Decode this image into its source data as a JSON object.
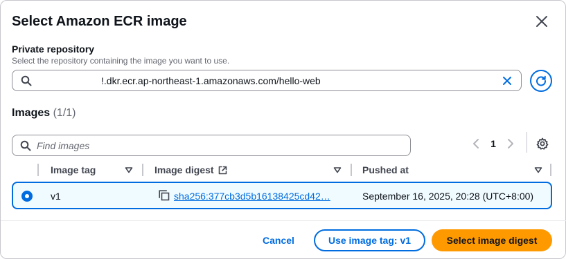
{
  "modal": {
    "title": "Select Amazon ECR image"
  },
  "repository": {
    "label": "Private repository",
    "description": "Select the repository containing the image you want to use.",
    "value": "!.dkr.ecr.ap-northeast-1.amazonaws.com/hello-web"
  },
  "images": {
    "heading": "Images",
    "count": "(1/1)",
    "search_placeholder": "Find images",
    "pagination": {
      "current_page": "1"
    },
    "columns": [
      {
        "label": "Image tag"
      },
      {
        "label": "Image digest"
      },
      {
        "label": "Pushed at"
      }
    ],
    "rows": [
      {
        "selected": true,
        "tag": "v1",
        "digest": "sha256:377cb3d5b16138425cd42…",
        "pushed_at": "September 16, 2025, 20:28 (UTC+8:00)"
      }
    ]
  },
  "footer": {
    "cancel_label": "Cancel",
    "use_tag_label": "Use image tag: v1",
    "select_digest_label": "Select image digest"
  },
  "colors": {
    "accent": "#006ce0",
    "primary_button": "#ff9900",
    "selected_row_bg": "#f0fbff"
  },
  "icons": [
    "close-icon",
    "search-icon",
    "clear-icon",
    "refresh-icon",
    "chevron-left-icon",
    "chevron-right-icon",
    "settings-icon",
    "sort-down-icon",
    "external-link-icon",
    "copy-icon",
    "radio-selected-icon"
  ]
}
